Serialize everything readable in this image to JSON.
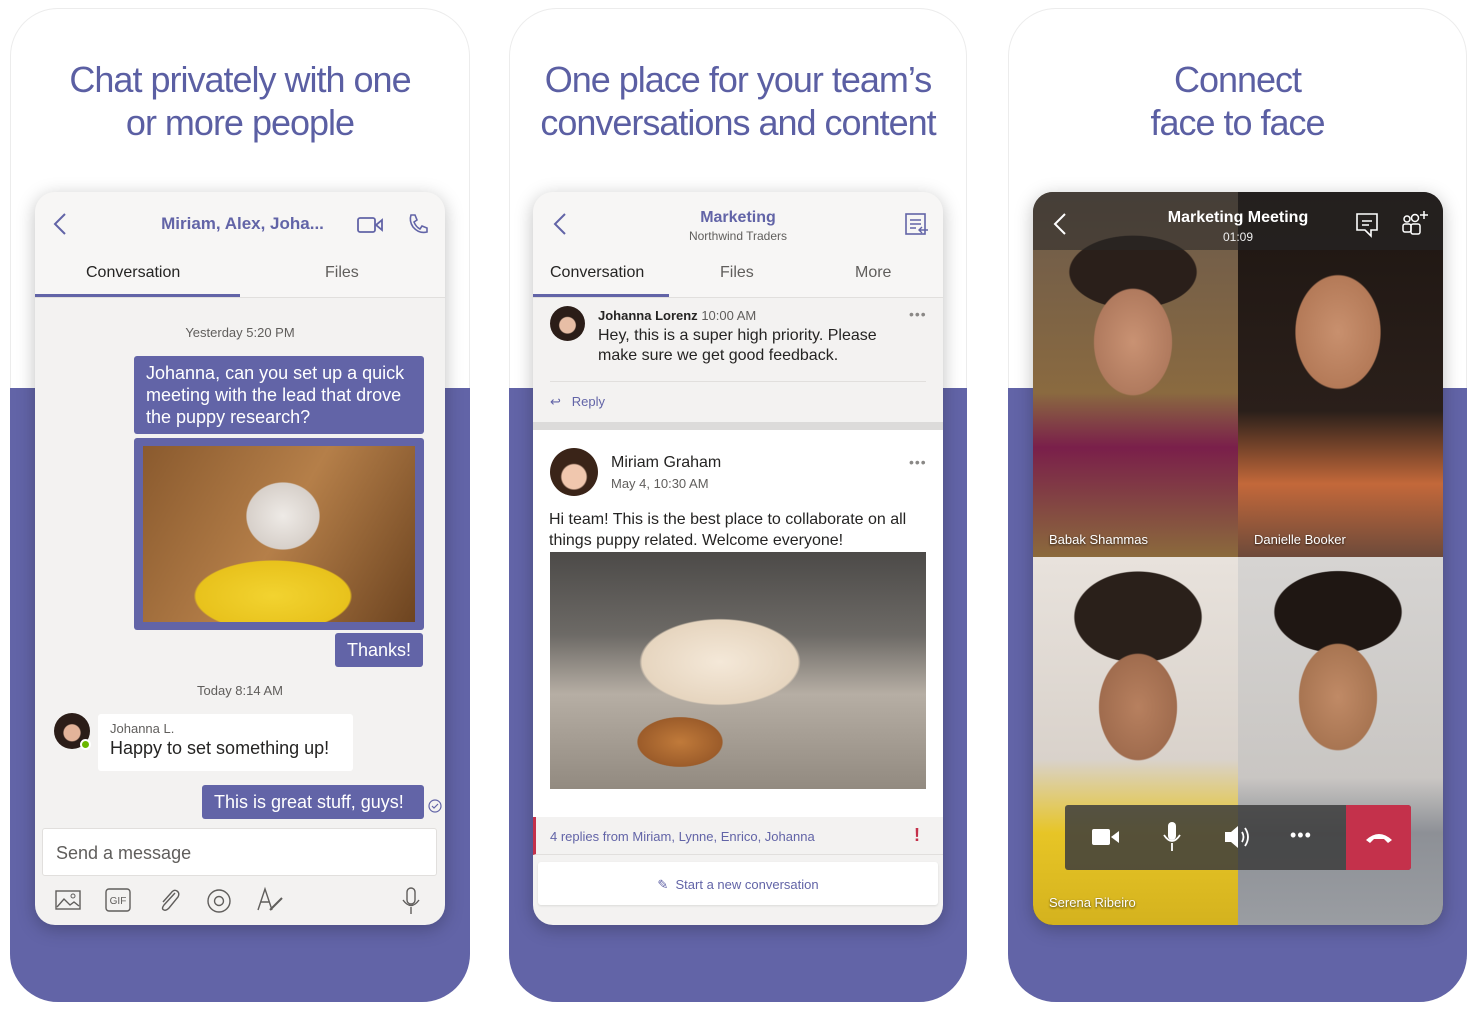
{
  "panels": [
    {
      "headline": [
        "Chat privately with one",
        "or more people"
      ],
      "chat": {
        "title": "Miriam, Alex, Joha...",
        "tabs": [
          {
            "label": "Conversation",
            "active": true
          },
          {
            "label": "Files",
            "active": false
          }
        ],
        "timestamp1": "Yesterday 5:20 PM",
        "message1": "Johanna, can you set up a quick meeting with the lead that drove the puppy research?",
        "message2": "Thanks!",
        "timestamp2": "Today 8:14 AM",
        "reply_author": "Johanna L.",
        "reply_text": "Happy to set something up!",
        "message3": "This is great stuff, guys!",
        "input_placeholder": "Send a message",
        "toolbar_icons": [
          "image-icon",
          "gif-icon",
          "attach-icon",
          "mention-icon",
          "format-icon",
          "mic-icon"
        ]
      }
    },
    {
      "headline": [
        "One place for your team’s",
        "conversations and content"
      ],
      "channel": {
        "title": "Marketing",
        "subtitle": "Northwind Traders",
        "tabs": [
          {
            "label": "Conversation",
            "active": true
          },
          {
            "label": "Files",
            "active": false
          },
          {
            "label": "More",
            "active": false
          }
        ],
        "post1": {
          "author": "Johanna Lorenz",
          "time": "10:00 AM",
          "text": "Hey, this is a super high priority. Please make sure we get good feedback.",
          "reply_label": "Reply"
        },
        "post2": {
          "author": "Miriam Graham",
          "time": "May 4, 10:30 AM",
          "text": "Hi team! This is the best place to collaborate on all things puppy related. Welcome everyone!"
        },
        "replies_summary": "4 replies from Miriam, Lynne, Enrico, Johanna",
        "priority_mark": "!",
        "new_conversation": "Start a new conversation"
      }
    },
    {
      "headline": [
        "Connect",
        "face to face"
      ],
      "meeting": {
        "title": "Marketing Meeting",
        "duration": "01:09",
        "participants": [
          "Babak Shammas",
          "Danielle Booker",
          "Serena Ribeiro",
          ""
        ],
        "controls": [
          "video-icon",
          "mic-icon",
          "speaker-icon",
          "more-icon",
          "hang-up-icon"
        ]
      }
    }
  ],
  "colors": {
    "brand": "#6264a7",
    "hangup": "#c4314b",
    "background": "#f3f2f1"
  }
}
